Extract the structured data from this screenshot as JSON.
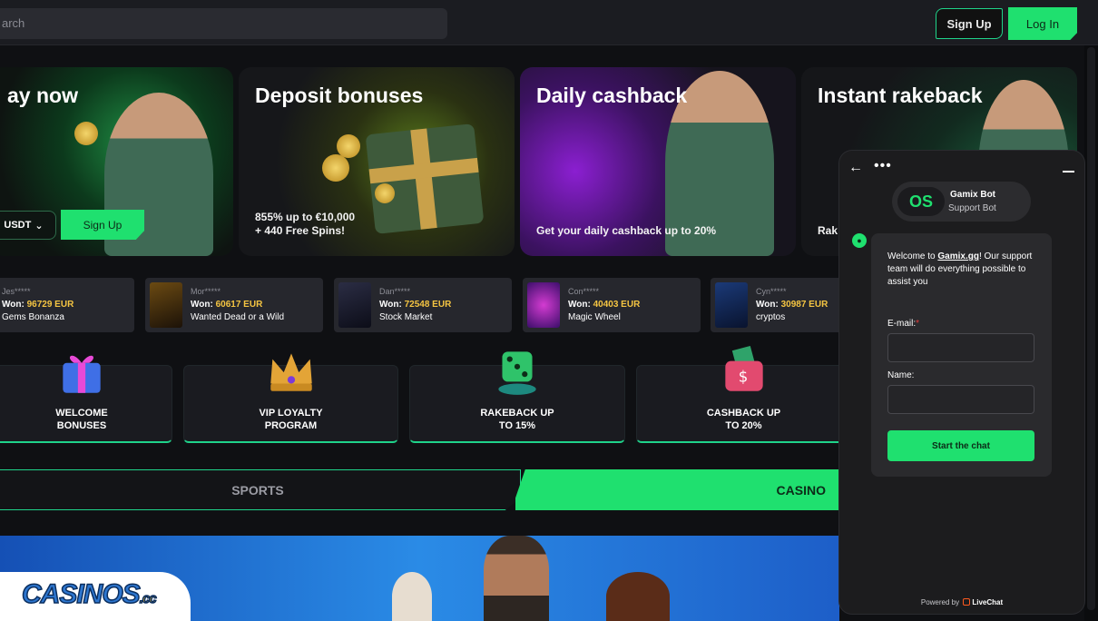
{
  "header": {
    "search_placeholder": "arch",
    "signup_label": "Sign Up",
    "login_label": "Log In"
  },
  "promos": [
    {
      "title": "ay now",
      "currency": "USDT",
      "cta": "Sign Up"
    },
    {
      "title": "Deposit bonuses",
      "sub1": "855% up to €10,000",
      "sub2": "+ 440 Free Spins!"
    },
    {
      "title": "Daily cashback",
      "sub1": "Get your daily cashback up to 20%"
    },
    {
      "title": "Instant rakeback",
      "sub1": "Rak"
    }
  ],
  "wins": [
    {
      "nick": "Jes*****",
      "won_prefix": "Won: ",
      "amount": "96729 EUR",
      "game": "Gems Bonanza"
    },
    {
      "nick": "Mor*****",
      "won_prefix": "Won: ",
      "amount": "60617 EUR",
      "game": "Wanted Dead or a Wild"
    },
    {
      "nick": "Dan*****",
      "won_prefix": "Won: ",
      "amount": "72548 EUR",
      "game": "Stock Market"
    },
    {
      "nick": "Con*****",
      "won_prefix": "Won: ",
      "amount": "40403 EUR",
      "game": "Magic Wheel"
    },
    {
      "nick": "Cyn*****",
      "won_prefix": "Won: ",
      "amount": "30987 EUR",
      "game": "cryptos"
    }
  ],
  "features": [
    {
      "label": "WELCOME\nBONUSES",
      "icon": "gift-icon"
    },
    {
      "label": "VIP LOYALTY\nPROGRAM",
      "icon": "crown-icon"
    },
    {
      "label": "RAKEBACK UP\nTO 15%",
      "icon": "dice-icon"
    },
    {
      "label": "CASHBACK UP\nTO 20%",
      "icon": "wallet-icon"
    }
  ],
  "tabs": {
    "sports": "SPORTS",
    "casino": "CASINO"
  },
  "branding": {
    "logo": "CASINOS",
    "logo_suffix": ".cc"
  },
  "chat": {
    "bot_name": "Gamix Bot",
    "bot_role": "Support Bot",
    "bot_logo": "OS",
    "welcome_pre": "Welcome to ",
    "welcome_link": "Gamix.gg",
    "welcome_post": "! Our support team will do everything possible to assist you",
    "email_label": "E-mail:",
    "email_req": "*",
    "name_label": "Name:",
    "start_label": "Start the chat",
    "powered_pre": "Powered by ",
    "powered_brand": "LiveChat"
  },
  "colors": {
    "accent": "#1fe06f",
    "won_amount": "#f5c542",
    "background": "#0f1013"
  }
}
